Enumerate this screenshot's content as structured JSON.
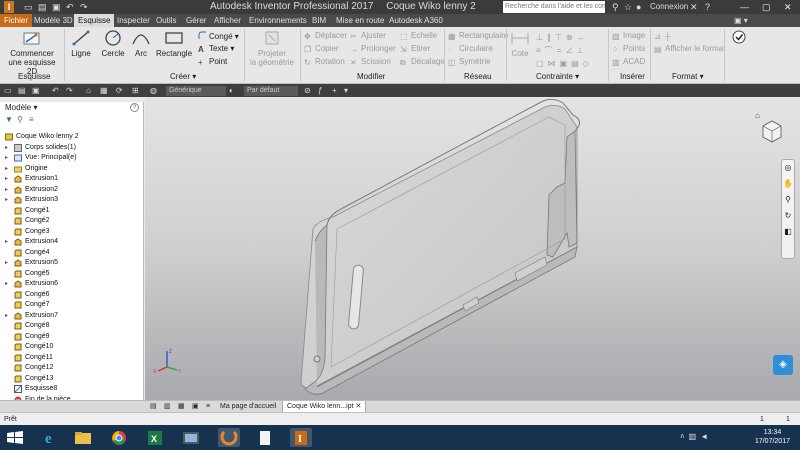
{
  "window": {
    "app_title": "Autodesk Inventor Professional 2017",
    "doc_title": "Coque Wiko lenny 2",
    "search_placeholder": "Recherche dans l'aide et les com",
    "connexion": "Connexion",
    "app_icon": "I"
  },
  "menu": {
    "tabs": [
      "Fichier",
      "Modèle 3D",
      "Esquisse",
      "Inspecter",
      "Outils",
      "Gérer",
      "Afficher",
      "Environnements",
      "BIM",
      "Mise en route",
      "Autodesk A360"
    ],
    "active_tab": "Esquisse"
  },
  "ribbon": {
    "esquisse": {
      "start_line1": "Commencer",
      "start_line2": "une esquisse 2D",
      "panel": "Esquisse"
    },
    "creer": {
      "ligne": "Ligne",
      "cercle": "Cercle",
      "arc": "Arc",
      "rectangle": "Rectangle",
      "conge": "Congé",
      "texte": "Texte",
      "point": "Point",
      "panel": "Créer"
    },
    "projeter": {
      "line1": "Projeter",
      "line2": "la géométrie"
    },
    "modifier": {
      "deplacer": "Déplacer",
      "copier": "Copier",
      "rotation": "Rotation",
      "ajuster": "Ajuster",
      "prolonger": "Prolonger",
      "scission": "Scission",
      "echelle": "Echelle",
      "etirer": "Etirer",
      "decalage": "Décalage",
      "panel": "Modifier"
    },
    "reseau": {
      "rectangulaire": "Rectangulaire",
      "circulaire": "Circulaire",
      "symetrie": "Symétrie",
      "panel": "Réseau"
    },
    "contrainte": {
      "cote": "Cote",
      "panel": "Contrainte"
    },
    "inserer": {
      "image": "Image",
      "points": "Points",
      "acad": "ACAD",
      "panel": "Insérer"
    },
    "format": {
      "afficher_format": "Afficher le format",
      "panel": "Format"
    }
  },
  "qat": {
    "material": "Générique",
    "appearance": "Par défaut"
  },
  "browser": {
    "title": "Modèle",
    "help": "?",
    "items": [
      {
        "label": "Coque Wiko lenny 2",
        "icon": "part-icon",
        "expand": ""
      },
      {
        "label": "Corps solides(1)",
        "icon": "solid-bodies-icon",
        "expand": "▸"
      },
      {
        "label": "Vue: Principal(e)",
        "icon": "view-icon",
        "expand": "▸"
      },
      {
        "label": "Origine",
        "icon": "folder-icon",
        "expand": "▸"
      },
      {
        "label": "Extrusion1",
        "icon": "extrusion-icon",
        "expand": "▸"
      },
      {
        "label": "Extrusion2",
        "icon": "extrusion-icon",
        "expand": "▸"
      },
      {
        "label": "Extrusion3",
        "icon": "extrusion-icon",
        "expand": "▸"
      },
      {
        "label": "Congé1",
        "icon": "fillet-icon",
        "expand": ""
      },
      {
        "label": "Congé2",
        "icon": "fillet-icon",
        "expand": ""
      },
      {
        "label": "Congé3",
        "icon": "fillet-icon",
        "expand": ""
      },
      {
        "label": "Extrusion4",
        "icon": "extrusion-icon",
        "expand": "▸"
      },
      {
        "label": "Congé4",
        "icon": "fillet-icon",
        "expand": ""
      },
      {
        "label": "Extrusion5",
        "icon": "extrusion-icon",
        "expand": "▸"
      },
      {
        "label": "Congé5",
        "icon": "fillet-icon",
        "expand": ""
      },
      {
        "label": "Extrusion6",
        "icon": "extrusion-icon",
        "expand": "▸"
      },
      {
        "label": "Congé6",
        "icon": "fillet-icon",
        "expand": ""
      },
      {
        "label": "Congé7",
        "icon": "fillet-icon",
        "expand": ""
      },
      {
        "label": "Extrusion7",
        "icon": "extrusion-icon",
        "expand": "▸"
      },
      {
        "label": "Congé8",
        "icon": "fillet-icon",
        "expand": ""
      },
      {
        "label": "Congé9",
        "icon": "fillet-icon",
        "expand": ""
      },
      {
        "label": "Congé10",
        "icon": "fillet-icon",
        "expand": ""
      },
      {
        "label": "Congé11",
        "icon": "fillet-icon",
        "expand": ""
      },
      {
        "label": "Congé12",
        "icon": "fillet-icon",
        "expand": ""
      },
      {
        "label": "Congé13",
        "icon": "fillet-icon",
        "expand": ""
      },
      {
        "label": "Esquisse8",
        "icon": "sketch-icon",
        "expand": ""
      },
      {
        "label": "Fin de la pièce",
        "icon": "end-of-part-icon",
        "expand": ""
      }
    ]
  },
  "doc_tabs": {
    "home": "Ma page d'accueil",
    "active": "Coque Wiko lenn...ipt"
  },
  "status": {
    "text": "Prêt",
    "count1": "1",
    "count2": "1"
  },
  "clock": {
    "time": "13:34",
    "date": "17/07/2017"
  },
  "colors": {
    "file_tab": "#c96a18",
    "taskbar": "#16324f",
    "viewport_top": "#e4e4e6",
    "viewport_bottom": "#a9a9ad"
  }
}
